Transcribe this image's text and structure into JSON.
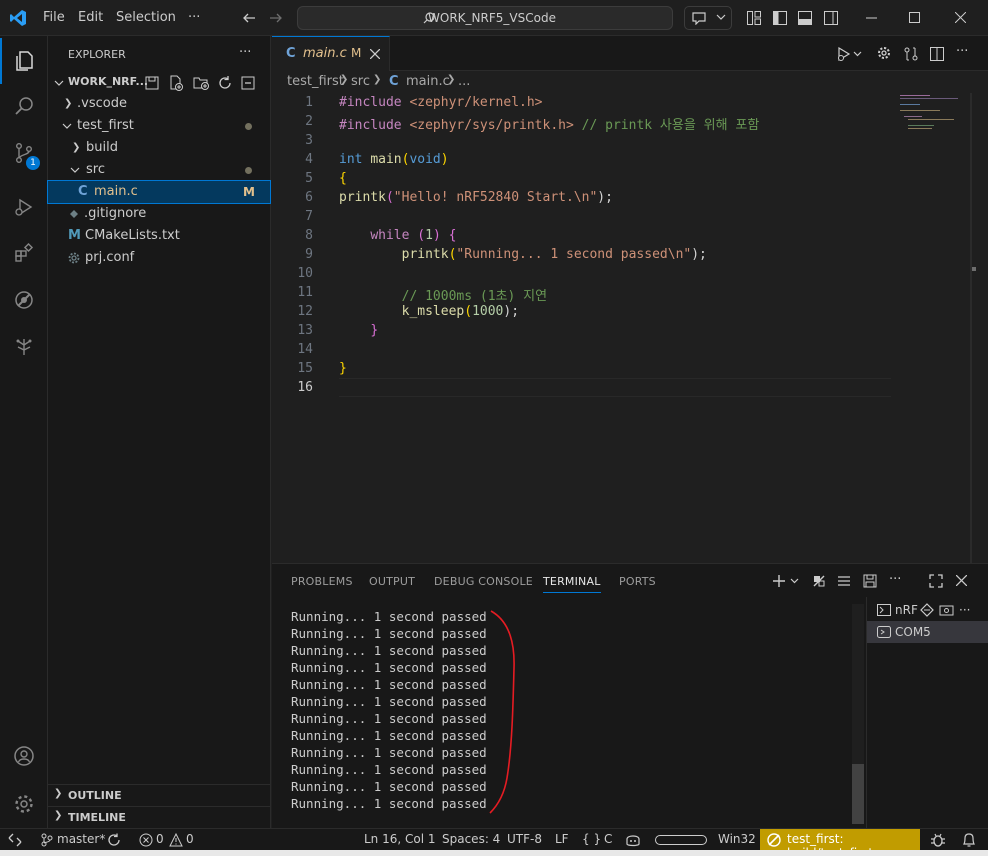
{
  "titlebar": {
    "menu": [
      "File",
      "Edit",
      "Selection",
      "···"
    ],
    "search_text": "WORK_NRF5_VSCode"
  },
  "activitybar": {
    "scm_badge": "1"
  },
  "explorer": {
    "header": "EXPLORER",
    "more": "···",
    "root": "WORK_NRF...",
    "items": [
      {
        "label": ".vscode"
      },
      {
        "label": "test_first"
      },
      {
        "label": "build"
      },
      {
        "label": "src"
      },
      {
        "label": "main.c",
        "badge": "M"
      },
      {
        "label": ".gitignore"
      },
      {
        "label": "CMakeLists.txt"
      },
      {
        "label": "prj.conf"
      }
    ],
    "outline": "OUTLINE",
    "timeline": "TIMELINE"
  },
  "editor": {
    "tab_label": "main.c",
    "tab_badge": "M",
    "breadcrumb": [
      "test_first",
      "src",
      "main.c",
      "..."
    ],
    "line_numbers": [
      "1",
      "2",
      "3",
      "4",
      "5",
      "6",
      "7",
      "8",
      "9",
      "10",
      "11",
      "12",
      "13",
      "14",
      "15",
      "16"
    ],
    "code": {
      "l1_dir": "#include",
      "l1_path": "<zephyr/kernel.h>",
      "l2_dir": "#include",
      "l2_path": "<zephyr/sys/printk.h>",
      "l2_comment": "// printk 사용을 위해 포함",
      "l4_type": "int",
      "l4_fn": "main",
      "l4_arg": "void",
      "l5": "{",
      "l6_fn": "printk",
      "l6_str": "\"Hello! nRF52840 Start.\\n\"",
      "l6_end": ");",
      "l8_kw": "while",
      "l8_num": "1",
      "l9_fn": "printk",
      "l9_str": "\"Running... 1 second passed\\n\"",
      "l9_end": ");",
      "l11_comment": "// 1000ms (1초) 지연",
      "l12_fn": "k_msleep",
      "l12_num": "1000",
      "l12_end": ");",
      "l13": "}",
      "l15": "}"
    }
  },
  "panel": {
    "tabs": [
      "PROBLEMS",
      "OUTPUT",
      "DEBUG CONSOLE",
      "TERMINAL",
      "PORTS"
    ],
    "active_tab": "TERMINAL",
    "terminal_lines": [
      "Running... 1 second passed",
      "Running... 1 second passed",
      "Running... 1 second passed",
      "Running... 1 second passed",
      "Running... 1 second passed",
      "Running... 1 second passed",
      "Running... 1 second passed",
      "Running... 1 second passed",
      "Running... 1 second passed",
      "Running... 1 second passed",
      "Running... 1 second passed",
      "Running... 1 second passed"
    ],
    "terminal_list": [
      "nRF",
      "COM5"
    ]
  },
  "statusbar": {
    "branch": "master*",
    "errors": "0",
    "warnings": "0",
    "position": "Ln 16, Col 1",
    "spaces": "Spaces: 4",
    "encoding": "UTF-8",
    "eol": "LF",
    "language": "C",
    "platform": "Win32",
    "build": "test_first: build/test_first"
  },
  "colors": {
    "accent": "#0078d4",
    "annotation": "#e51c23",
    "build_bg": "#c19c00"
  }
}
